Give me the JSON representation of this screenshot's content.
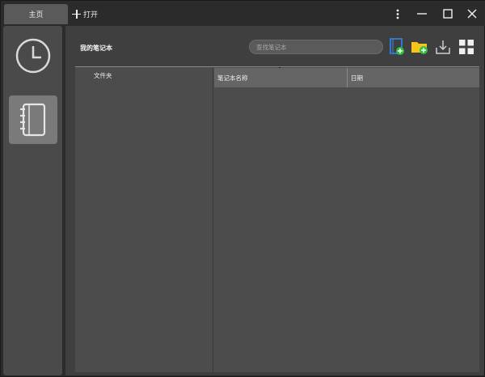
{
  "titlebar": {
    "tabs": [
      {
        "label": "主页",
        "active": true
      },
      {
        "label": "打开",
        "icon": "plus-icon"
      }
    ],
    "controls": [
      "more-vertical-icon",
      "minimize-icon",
      "maximize-icon",
      "close-icon"
    ]
  },
  "sidebar": {
    "items": [
      {
        "name": "recent",
        "icon": "clock-icon",
        "active": false
      },
      {
        "name": "notebooks",
        "icon": "notebook-icon",
        "active": true
      }
    ]
  },
  "main": {
    "title": "我的笔记本",
    "search": {
      "placeholder": "查找笔记本",
      "value": ""
    },
    "toolbar": [
      "new-notebook-icon",
      "new-folder-icon",
      "import-icon",
      "grid-view-icon"
    ],
    "folder_panel": {
      "label": "文件夹"
    },
    "table": {
      "columns": [
        "笔记本名称",
        "日期"
      ],
      "rows": []
    }
  },
  "colors": {
    "background": "#2b2b2b",
    "sidebar": "#4a4a4a",
    "active_sidebar": "#7a7a7a",
    "header": "#656565",
    "accent_blue": "#2f7fd8",
    "accent_green": "#2fbf3f",
    "folder_yellow": "#f5c518"
  }
}
